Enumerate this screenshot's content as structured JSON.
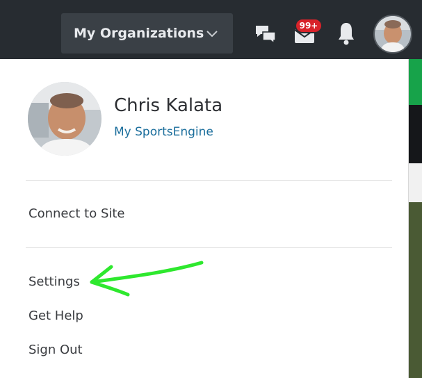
{
  "header": {
    "org_button_label": "My Organizations",
    "mail_badge": "99+"
  },
  "user_menu": {
    "name": "Chris Kalata",
    "profile_link": "My SportsEngine",
    "items": [
      {
        "label": "Connect to Site"
      },
      {
        "label": "Settings"
      },
      {
        "label": "Get Help"
      },
      {
        "label": "Sign Out"
      }
    ]
  },
  "icons": {
    "org_dropdown": "chevron-down-icon",
    "messages": "chat-bubbles-icon",
    "mail": "envelope-icon",
    "notifications": "bell-icon",
    "annotation": "green-arrow-icon"
  },
  "colors": {
    "topbar": "#272c31",
    "badge": "#d8232a",
    "link": "#1b6e9c",
    "annotation_arrow": "#2ee82e"
  }
}
